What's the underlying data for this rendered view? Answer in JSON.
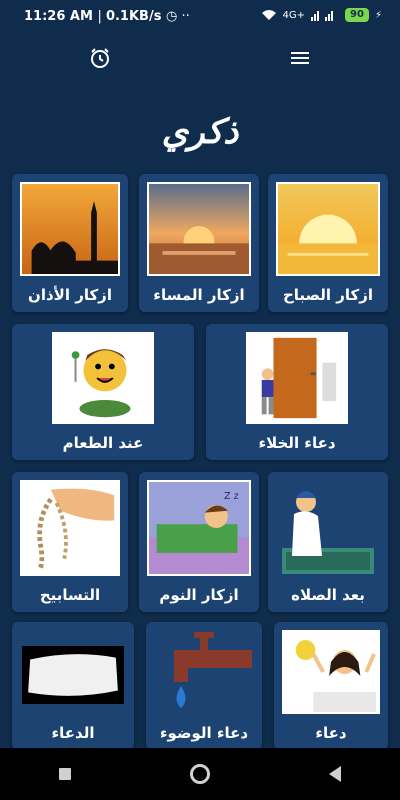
{
  "status": {
    "time": "11:26 AM",
    "speed": "0.1KB/s",
    "network": "4G+",
    "battery": "90"
  },
  "app": {
    "title": "ذكري"
  },
  "row1": [
    {
      "label": "ازكار الأذان"
    },
    {
      "label": "ازكار المساء"
    },
    {
      "label": "ازكار الصباح"
    }
  ],
  "row2": [
    {
      "label": "عند الطعام"
    },
    {
      "label": "دعاء الخلاء"
    }
  ],
  "row3": [
    {
      "label": "التسابيح"
    },
    {
      "label": "ازكار النوم"
    },
    {
      "label": "بعد الصلاه"
    }
  ],
  "row4": [
    {
      "label": "الدعاء"
    },
    {
      "label": "دعاء الوضوء"
    },
    {
      "label": "دعاء"
    }
  ],
  "colors": {
    "background": "#0f2c4d",
    "card": "#1c4372"
  }
}
